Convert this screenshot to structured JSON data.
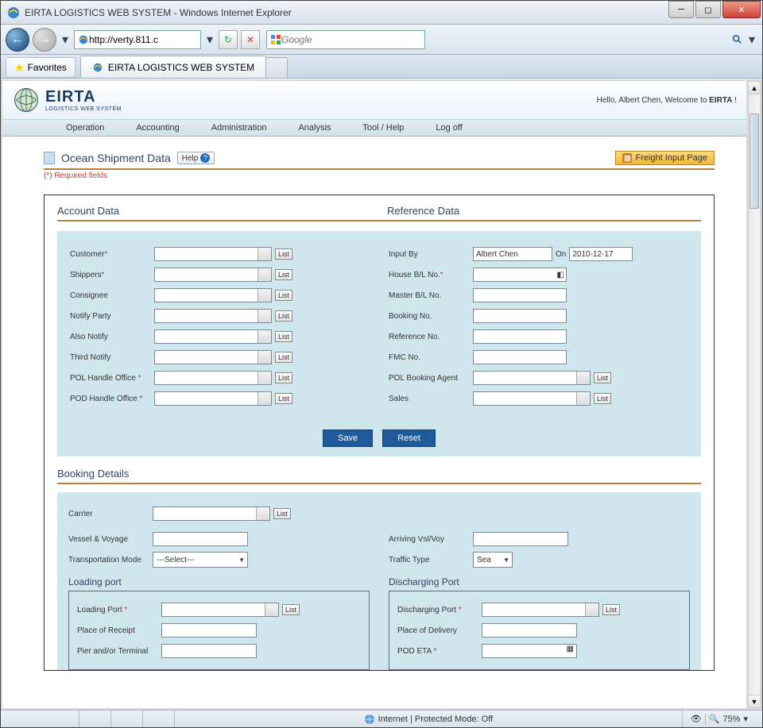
{
  "window": {
    "title": "EIRTA LOGISTICS WEB SYSTEM - Windows Internet Explorer",
    "url": "http://verty.811.c",
    "search_placeholder": "Google",
    "favorites_label": "Favorites",
    "tab_title": "EIRTA LOGISTICS WEB SYSTEM"
  },
  "app": {
    "brand": "EIRTA",
    "brand_sub": "LOGISTICS WEB SYSTEM",
    "welcome_prefix": "Hello, ",
    "welcome_user": "Albert Chen",
    "welcome_mid": ", Welcome to ",
    "welcome_brand": "EIRTA",
    "welcome_suffix": " !"
  },
  "nav": {
    "items": [
      "Operation",
      "Accounting",
      "Administration",
      "Analysis",
      "Tool / Help",
      "Log off"
    ]
  },
  "page": {
    "title": "Ocean Shipment Data",
    "help_label": "Help",
    "freight_btn": "Freight Input Page",
    "required_note": "(*) Required fields"
  },
  "account": {
    "heading": "Account Data",
    "fields": {
      "customer": "Customer",
      "shippers": "Shippers",
      "consignee": "Consignee",
      "notify": "Notify Party",
      "also_notify": "Also Notify",
      "third_notify": "Third Notify",
      "pol_office": "POL Handle Office",
      "pod_office": "POD Handle Office"
    },
    "list_label": "List"
  },
  "reference": {
    "heading": "Reference Data",
    "fields": {
      "input_by": "Input By",
      "input_by_value": "Albert Chen",
      "on_label": "On",
      "on_value": "2010-12-17",
      "house_bl": "House B/L No.",
      "master_bl": "Master B/L No.",
      "booking_no": "Booking No.",
      "reference_no": "Reference No.",
      "fmc_no": "FMC No.",
      "pol_agent": "POL Booking Agent",
      "sales": "Sales"
    }
  },
  "buttons": {
    "save": "Save",
    "reset": "Reset"
  },
  "booking": {
    "heading": "Booking Details",
    "carrier": "Carrier",
    "vessel": "Vessel & Voyage",
    "arriving": "Arriving Vsl/Voy",
    "trans_mode": "Transportation Mode",
    "trans_mode_value": "---Select---",
    "traffic_type": "Traffic Type",
    "traffic_type_value": "Sea",
    "loading_heading": "Loading port",
    "discharging_heading": "Discharging Port",
    "loading_port": "Loading Port",
    "place_receipt": "Place of Receipt",
    "pier_terminal": "Pier and/or Terminal",
    "discharging_port": "Discharging Port",
    "place_delivery": "Place of Delivery",
    "pod_eta": "POD ETA"
  },
  "status": {
    "zone": "Internet | Protected Mode: Off",
    "zoom": "75%"
  }
}
